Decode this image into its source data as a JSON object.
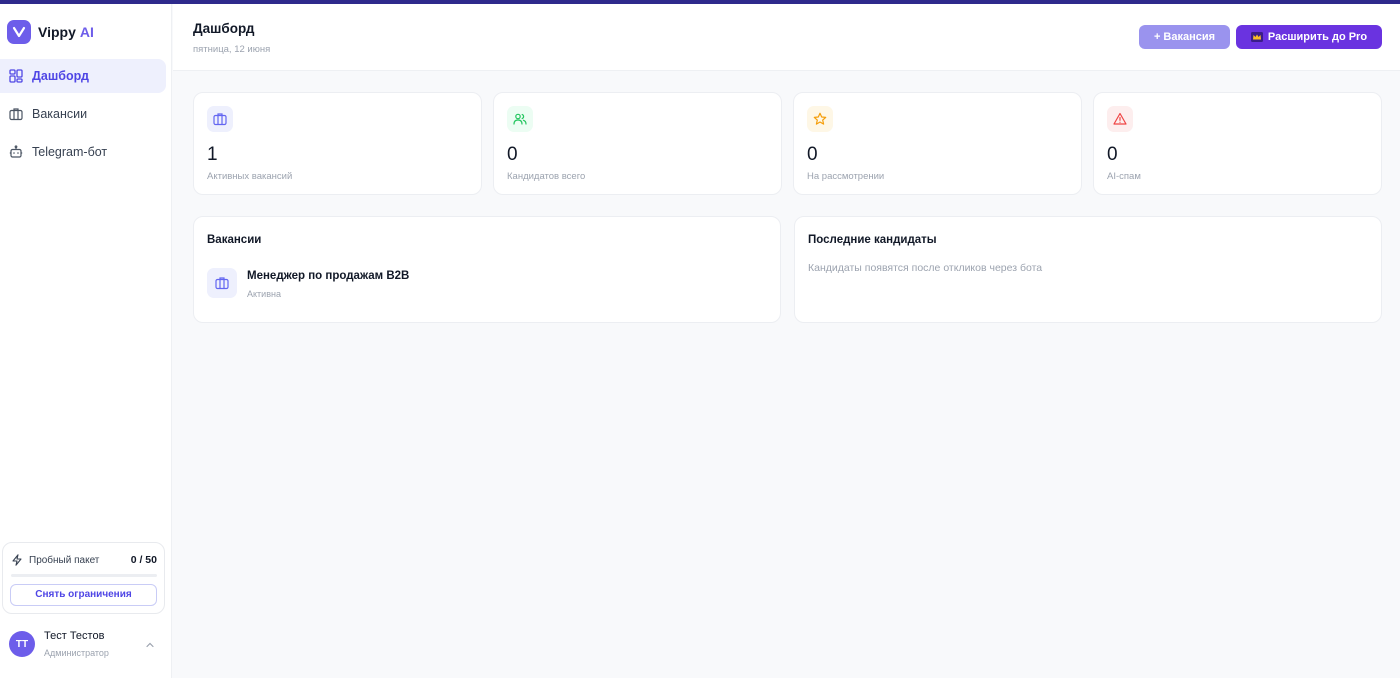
{
  "brand": {
    "name": "Vippy",
    "suffix": "AI"
  },
  "nav": [
    {
      "label": "Дашборд",
      "icon": "dashboard-grid-icon",
      "active": true
    },
    {
      "label": "Вакансии",
      "icon": "briefcase-icon",
      "active": false
    },
    {
      "label": "Telegram-бот",
      "icon": "bot-icon",
      "active": false
    }
  ],
  "trial": {
    "label": "Пробный пакет",
    "count": "0 / 50",
    "used": 0,
    "total": 50,
    "button": "Снять ограничения"
  },
  "user": {
    "initials": "TT",
    "name": "Тест Тестов",
    "role": "Администратор"
  },
  "header": {
    "title": "Дашборд",
    "date": "пятница, 12 июня",
    "add_vacancy": "+ Вакансия",
    "upgrade": "Расширить до Pro"
  },
  "stats": [
    {
      "value": "1",
      "label": "Активных вакансий",
      "icon": "briefcase-icon",
      "color": "#6366f1"
    },
    {
      "value": "0",
      "label": "Кандидатов всего",
      "icon": "users-icon",
      "color": "#22c55e"
    },
    {
      "value": "0",
      "label": "На рассмотрении",
      "icon": "star-icon",
      "color": "#f59e0b"
    },
    {
      "value": "0",
      "label": "AI-спам",
      "icon": "alert-triangle-icon",
      "color": "#ef4444"
    }
  ],
  "vacancies_panel": {
    "title": "Вакансии",
    "items": [
      {
        "title": "Менеджер по продажам B2B",
        "status": "Активна"
      }
    ]
  },
  "candidates_panel": {
    "title": "Последние кандидаты",
    "empty": "Кандидаты появятся после откликов через бота"
  },
  "colors": {
    "accent": "#6d5dea",
    "accent_dark": "#6a33e0",
    "top_strip": "#2e2a8c"
  }
}
